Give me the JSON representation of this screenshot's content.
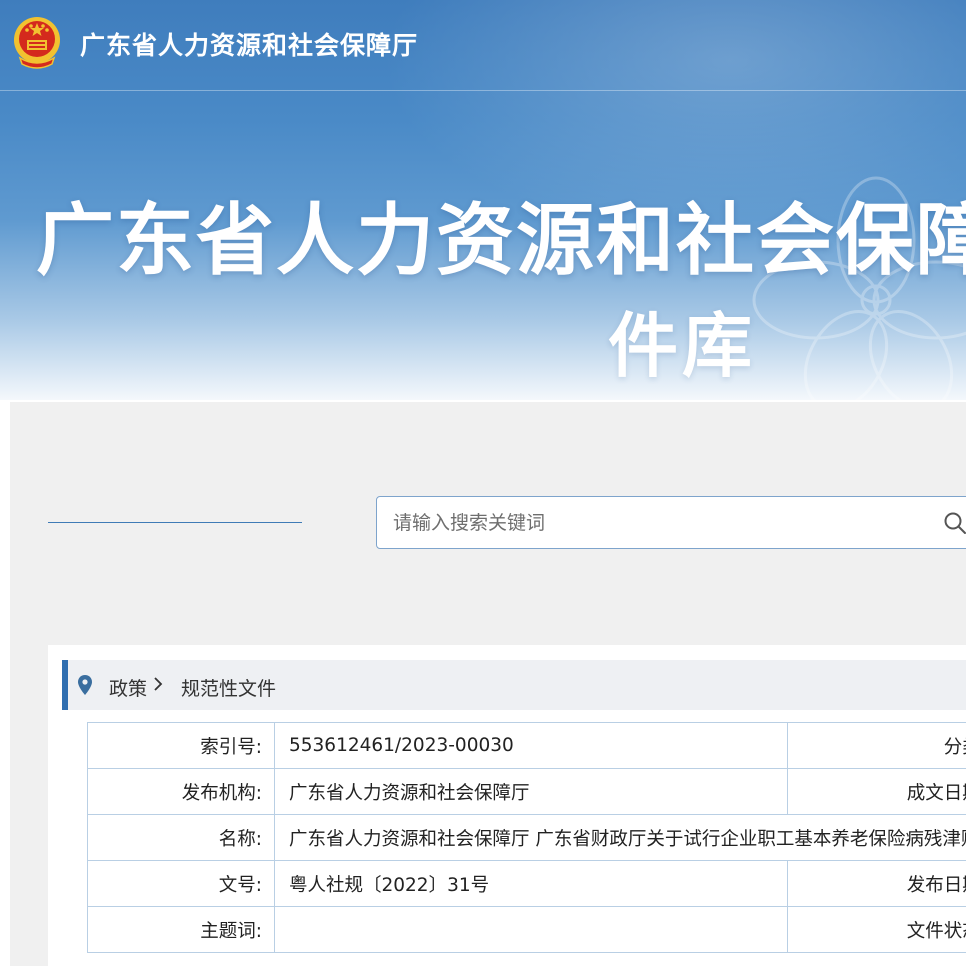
{
  "header": {
    "site_name": "广东省人力资源和社会保障厅",
    "banner_title_line1": "广东省人力资源和社会保障厅",
    "banner_title_line2": "件库"
  },
  "search": {
    "placeholder": "请输入搜索关键词",
    "value": "",
    "icon": "search-icon"
  },
  "breadcrumb": {
    "icon": "location-pin-icon",
    "items": [
      "政策",
      "规范性文件"
    ],
    "separator_icon": "chevron-right-icon"
  },
  "document_info": {
    "index_no_label": "索引号:",
    "index_no_value": "553612461/2023-00030",
    "category_label": "分类:",
    "issuer_label": "发布机构:",
    "issuer_value": "广东省人力资源和社会保障厅",
    "written_date_label": "成文日期:",
    "name_label": "名称:",
    "name_value": "广东省人力资源和社会保障厅 广东省财政厅关于试行企业职工基本养老保险病残津贴衤",
    "doc_no_label": "文号:",
    "doc_no_value": "粤人社规〔2022〕31号",
    "publish_date_label": "发布日期:",
    "subject_label": "主题词:",
    "subject_value": "",
    "status_label": "文件状态:"
  },
  "colors": {
    "header_blue": "#4a8ac7",
    "accent": "#2f6eb0",
    "table_border": "#b9cfe4",
    "emblem_red": "#d42a1d",
    "emblem_gold": "#f2c230"
  }
}
